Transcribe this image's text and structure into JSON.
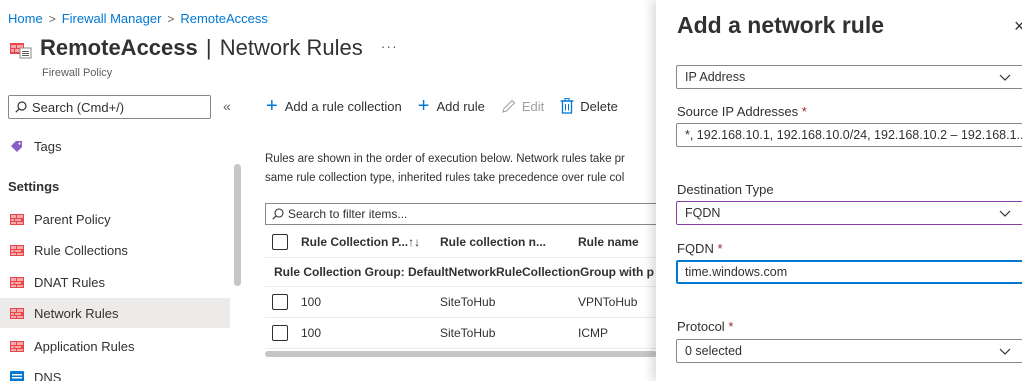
{
  "breadcrumb": {
    "home": "Home",
    "firewall_manager": "Firewall Manager",
    "remote_access": "RemoteAccess",
    "separator": ">"
  },
  "page": {
    "title_resource": "RemoteAccess",
    "title_separator": "|",
    "title_section": "Network Rules",
    "subtitle": "Firewall Policy",
    "more": "···"
  },
  "sidebar": {
    "search_placeholder": "Search (Cmd+/)",
    "collapse": "«",
    "tags": "Tags",
    "settings_heading": "Settings",
    "items": [
      {
        "label": "Parent Policy",
        "icon": "firewall-icon"
      },
      {
        "label": "Rule Collections",
        "icon": "firewall-icon"
      },
      {
        "label": "DNAT Rules",
        "icon": "firewall-icon"
      },
      {
        "label": "Network Rules",
        "icon": "firewall-icon",
        "selected": true
      },
      {
        "label": "Application Rules",
        "icon": "firewall-icon"
      },
      {
        "label": "DNS",
        "icon": "dns-icon"
      }
    ]
  },
  "toolbar": {
    "add_collection": "Add a rule collection",
    "add_rule": "Add rule",
    "edit": "Edit",
    "delete": "Delete"
  },
  "info": {
    "line1": "Rules are shown in the order of execution below. Network rules take pr",
    "line2": "same rule collection type, inherited rules take precedence over rule col"
  },
  "filter": {
    "placeholder": "Search to filter items..."
  },
  "table": {
    "headers": [
      "Rule Collection P...↑↓",
      "Rule collection n...",
      "Rule name"
    ],
    "group": "Rule Collection Group: DefaultNetworkRuleCollectionGroup with p",
    "rows": [
      [
        "100",
        "SiteToHub",
        "VPNToHub"
      ],
      [
        "100",
        "SiteToHub",
        "ICMP"
      ]
    ]
  },
  "panel": {
    "title": "Add a network rule",
    "close": "×",
    "source_type": "IP Address",
    "source_label": "Source IP Addresses",
    "source_value": "*, 192.168.10.1, 192.168.10.0/24, 192.168.10.2 – 192.168.1...",
    "dest_type_label": "Destination Type",
    "dest_type_value": "FQDN",
    "fqdn_label": "FQDN",
    "fqdn_value": "time.windows.com",
    "protocol_label": "Protocol",
    "protocol_value": "0 selected",
    "required_mark": "*"
  },
  "colors": {
    "accent": "#0078d4",
    "focus_purple": "#8a3fa6",
    "required": "#a4262c"
  }
}
